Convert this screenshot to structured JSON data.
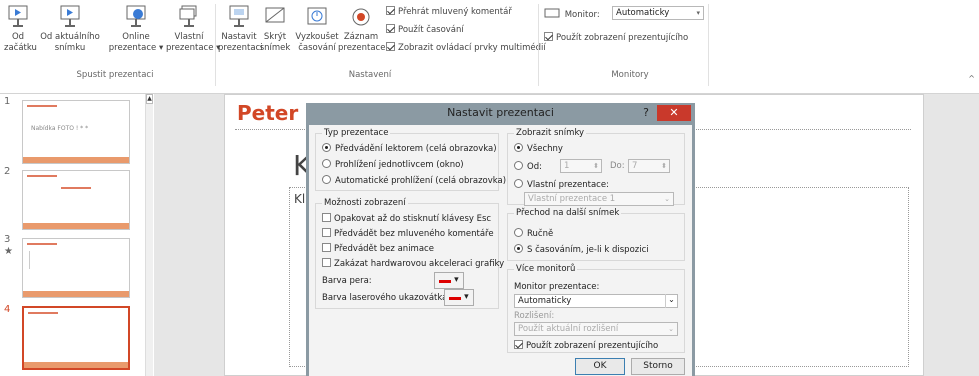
{
  "ribbon": {
    "group_start": {
      "buttons": [
        {
          "label": "Od\nzačátku",
          "icon": "from-beginning-icon"
        },
        {
          "label": "Od aktuálního\nsnímku",
          "icon": "from-current-slide-icon"
        },
        {
          "label": "Online\nprezentace ▾",
          "icon": "present-online-icon"
        },
        {
          "label": "Vlastní\nprezentace ▾",
          "icon": "custom-show-icon"
        }
      ],
      "label": "Spustit prezentaci"
    },
    "group_setup": {
      "buttons": [
        {
          "label": "Nastavit\nprezentaci",
          "icon": "setup-show-icon"
        },
        {
          "label": "Skrýt\nsnímek",
          "icon": "hide-slide-icon"
        },
        {
          "label": "Vyzkoušet\nčasování",
          "icon": "rehearse-timings-icon"
        },
        {
          "label": "Záznam\nprezentace ▾",
          "icon": "record-slideshow-icon"
        }
      ],
      "checks": [
        {
          "label": "Přehrát mluvený komentář",
          "checked": true
        },
        {
          "label": "Použít časování",
          "checked": true
        },
        {
          "label": "Zobrazit ovládací prvky multimédií",
          "checked": true
        }
      ],
      "label": "Nastavení"
    },
    "group_monitors": {
      "monitor_label": "Monitor:",
      "monitor_value": "Automaticky",
      "presenter_view_label": "Použít zobrazení prezentujícího",
      "label": "Monitory"
    }
  },
  "thumbnails": [
    {
      "num": "1",
      "text": "Nabídka FOTO ! * *"
    },
    {
      "num": "2",
      "text": ""
    },
    {
      "num": "3",
      "text": ""
    },
    {
      "num": "4",
      "text": ""
    }
  ],
  "slide": {
    "logo": "Peter",
    "big_letter": "K",
    "small_text": "Kl"
  },
  "dialog": {
    "title": "Nastavit prezentaci",
    "help": "?",
    "close": "✕",
    "type": {
      "legend": "Typ prezentace",
      "options": [
        {
          "label": "Předvádění lektorem (celá obrazovka)",
          "checked": true
        },
        {
          "label": "Prohlížení jednotlivcem (okno)",
          "checked": false
        },
        {
          "label": "Automatické prohlížení (celá obrazovka)",
          "checked": false
        }
      ]
    },
    "display": {
      "legend": "Možnosti zobrazení",
      "checks": [
        {
          "label": "Opakovat až do stisknutí klávesy Esc",
          "checked": false
        },
        {
          "label": "Předvádět bez mluveného komentáře",
          "checked": false
        },
        {
          "label": "Předvádět bez animace",
          "checked": false
        },
        {
          "label": "Zakázat hardwarovou akceleraci grafiky",
          "checked": false
        }
      ],
      "pen_color_label": "Barva pera:",
      "laser_color_label": "Barva laserového ukazovátka:"
    },
    "slides": {
      "legend": "Zobrazit snímky",
      "all_label": "Všechny",
      "from_label": "Od:",
      "from_value": "1",
      "to_label": "Do:",
      "to_value": "7",
      "custom_label": "Vlastní prezentace:",
      "custom_value": "Vlastní prezentace 1"
    },
    "advance": {
      "legend": "Přechod na další snímek",
      "manual_label": "Ručně",
      "timings_label": "S časováním, je-li k dispozici"
    },
    "monitors": {
      "legend": "Více monitorů",
      "monitor_label": "Monitor prezentace:",
      "monitor_value": "Automaticky",
      "res_label": "Rozlišení:",
      "res_value": "Použít aktuální rozlišení",
      "presenter_label": "Použít zobrazení prezentujícího"
    },
    "ok": "OK",
    "cancel": "Storno"
  }
}
